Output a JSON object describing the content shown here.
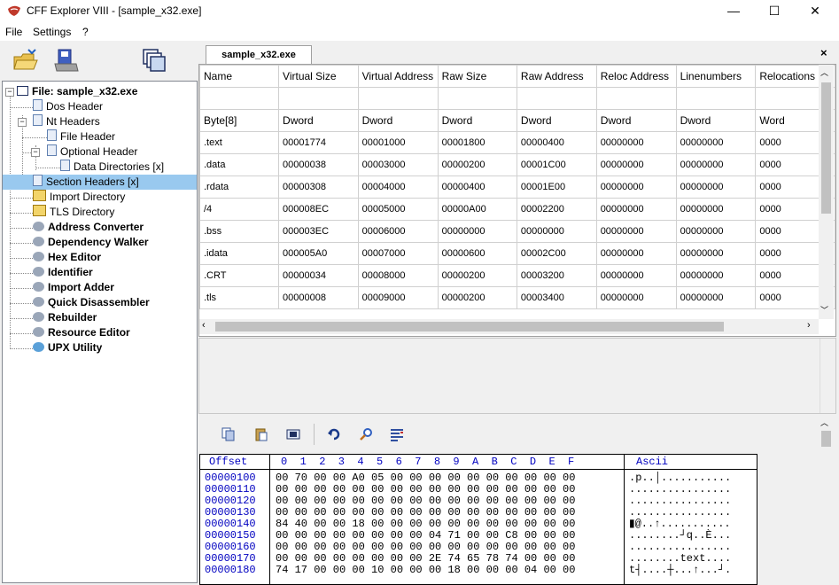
{
  "window": {
    "title": "CFF Explorer VIII - [sample_x32.exe]",
    "minimize": "—",
    "maximize": "☐",
    "close": "✕"
  },
  "menu": [
    "File",
    "Settings",
    "?"
  ],
  "tree": [
    {
      "label": "File: sample_x32.exe",
      "bold": true,
      "level": 0
    },
    {
      "label": "Dos Header",
      "level": 1
    },
    {
      "label": "Nt Headers",
      "level": 1
    },
    {
      "label": "File Header",
      "level": 2
    },
    {
      "label": "Optional Header",
      "level": 2
    },
    {
      "label": "Data Directories [x]",
      "level": 3
    },
    {
      "label": "Section Headers [x]",
      "level": 1,
      "selected": true
    },
    {
      "label": "Import Directory",
      "level": 1
    },
    {
      "label": "TLS Directory",
      "level": 1
    },
    {
      "label": "Address Converter",
      "bold": true,
      "level": 1
    },
    {
      "label": "Dependency Walker",
      "bold": true,
      "level": 1
    },
    {
      "label": "Hex Editor",
      "bold": true,
      "level": 1
    },
    {
      "label": "Identifier",
      "bold": true,
      "level": 1
    },
    {
      "label": "Import Adder",
      "bold": true,
      "level": 1
    },
    {
      "label": "Quick Disassembler",
      "bold": true,
      "level": 1
    },
    {
      "label": "Rebuilder",
      "bold": true,
      "level": 1
    },
    {
      "label": "Resource Editor",
      "bold": true,
      "level": 1
    },
    {
      "label": "UPX Utility",
      "bold": true,
      "level": 1
    }
  ],
  "tab": {
    "label": "sample_x32.exe",
    "close": "×"
  },
  "grid": {
    "columns": [
      "Name",
      "Virtual Size",
      "Virtual Address",
      "Raw Size",
      "Raw Address",
      "Reloc Address",
      "Linenumbers",
      "Relocations"
    ],
    "types": [
      "Byte[8]",
      "Dword",
      "Dword",
      "Dword",
      "Dword",
      "Dword",
      "Dword",
      "Word"
    ],
    "rows": [
      [
        ".text",
        "00001774",
        "00001000",
        "00001800",
        "00000400",
        "00000000",
        "00000000",
        "0000"
      ],
      [
        ".data",
        "00000038",
        "00003000",
        "00000200",
        "00001C00",
        "00000000",
        "00000000",
        "0000"
      ],
      [
        ".rdata",
        "00000308",
        "00004000",
        "00000400",
        "00001E00",
        "00000000",
        "00000000",
        "0000"
      ],
      [
        "/4",
        "000008EC",
        "00005000",
        "00000A00",
        "00002200",
        "00000000",
        "00000000",
        "0000"
      ],
      [
        ".bss",
        "000003EC",
        "00006000",
        "00000000",
        "00000000",
        "00000000",
        "00000000",
        "0000"
      ],
      [
        ".idata",
        "000005A0",
        "00007000",
        "00000600",
        "00002C00",
        "00000000",
        "00000000",
        "0000"
      ],
      [
        ".CRT",
        "00000034",
        "00008000",
        "00000200",
        "00003200",
        "00000000",
        "00000000",
        "0000"
      ],
      [
        ".tls",
        "00000008",
        "00009000",
        "00000200",
        "00003400",
        "00000000",
        "00000000",
        "0000"
      ]
    ]
  },
  "hex": {
    "offset_header": "Offset",
    "col_header": "0  1  2  3  4  5  6  7  8  9  A  B  C  D  E  F",
    "ascii_header": "Ascii",
    "rows": [
      {
        "off": "00000100",
        "bytes": "00 70 00 00 A0 05 00 00 00 00 00 00 00 00 00 00",
        "ascii": ".p..│..........."
      },
      {
        "off": "00000110",
        "bytes": "00 00 00 00 00 00 00 00 00 00 00 00 00 00 00 00",
        "ascii": "................"
      },
      {
        "off": "00000120",
        "bytes": "00 00 00 00 00 00 00 00 00 00 00 00 00 00 00 00",
        "ascii": "................"
      },
      {
        "off": "00000130",
        "bytes": "00 00 00 00 00 00 00 00 00 00 00 00 00 00 00 00",
        "ascii": "................"
      },
      {
        "off": "00000140",
        "bytes": "84 40 00 00 18 00 00 00 00 00 00 00 00 00 00 00",
        "ascii": "▮@..↑..........."
      },
      {
        "off": "00000150",
        "bytes": "00 00 00 00 00 00 00 00 04 71 00 00 C8 00 00 00",
        "ascii": "........┘q..È..."
      },
      {
        "off": "00000160",
        "bytes": "00 00 00 00 00 00 00 00 00 00 00 00 00 00 00 00",
        "ascii": "................"
      },
      {
        "off": "00000170",
        "bytes": "00 00 00 00 00 00 00 00 2E 74 65 78 74 00 00 00",
        "ascii": "........text...."
      },
      {
        "off": "00000180",
        "bytes": "74 17 00 00 00 10 00 00 00 18 00 00 00 04 00 00",
        "ascii": "t┤....┼...↑...┘."
      }
    ]
  }
}
